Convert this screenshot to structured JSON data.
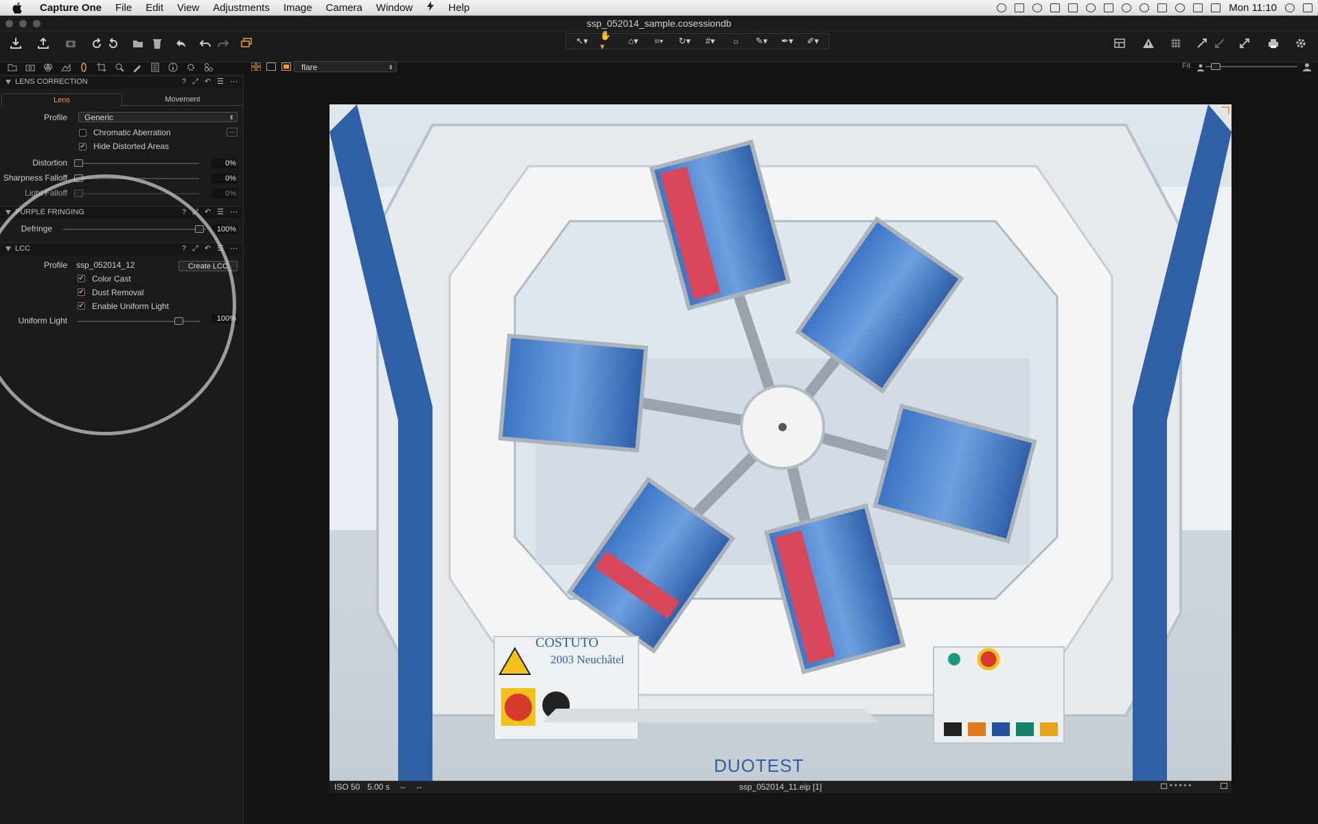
{
  "menubar": {
    "app_name": "Capture One",
    "items": [
      "File",
      "Edit",
      "View",
      "Adjustments",
      "Image",
      "Camera",
      "Window",
      "Help"
    ],
    "clock": "Mon 11:10"
  },
  "window": {
    "title": "ssp_052014_sample.cosessiondb"
  },
  "viewer": {
    "variant_name": "flare",
    "zoom_label": "Fit",
    "status_iso": "ISO 50",
    "status_shutter": "5.00 s",
    "status_dash1": "--",
    "status_dash2": "--",
    "status_filename": "ssp_052014_11.eip [1]"
  },
  "photo": {
    "label_left_line1": "COSTUTO",
    "label_left_line2": "2003 Neuchâtel",
    "brand": "DUOTEST"
  },
  "lens_correction": {
    "header": "LENS CORRECTION",
    "tab_lens": "Lens",
    "tab_movement": "Movement",
    "profile_label": "Profile",
    "profile_value": "Generic",
    "chromatic_aberration_label": "Chromatic Aberration",
    "chromatic_aberration_checked": false,
    "hide_distorted_label": "Hide Distorted Areas",
    "hide_distorted_checked": true,
    "distortion_label": "Distortion",
    "distortion_value": "0%",
    "sharpness_label": "Sharpness Falloff",
    "sharpness_value": "0%",
    "light_falloff_label": "Light Falloff",
    "light_falloff_value": "0%"
  },
  "purple_fringing": {
    "header": "PURPLE FRINGING",
    "defringe_label": "Defringe",
    "defringe_value": "100%",
    "defringe_level": 1.0
  },
  "lcc": {
    "header": "LCC",
    "profile_label": "Profile",
    "profile_value": "ssp_052014_12",
    "create_button": "Create LCC",
    "color_cast_label": "Color Cast",
    "dust_removal_label": "Dust Removal",
    "enable_uniform_label": "Enable Uniform Light",
    "uniform_light_label": "Uniform Light",
    "uniform_light_value": "100%",
    "uniform_light_level": 1.0
  },
  "colors": {
    "accent": "#f0a030",
    "panel": "#1b1b1b",
    "background": "#141414"
  }
}
